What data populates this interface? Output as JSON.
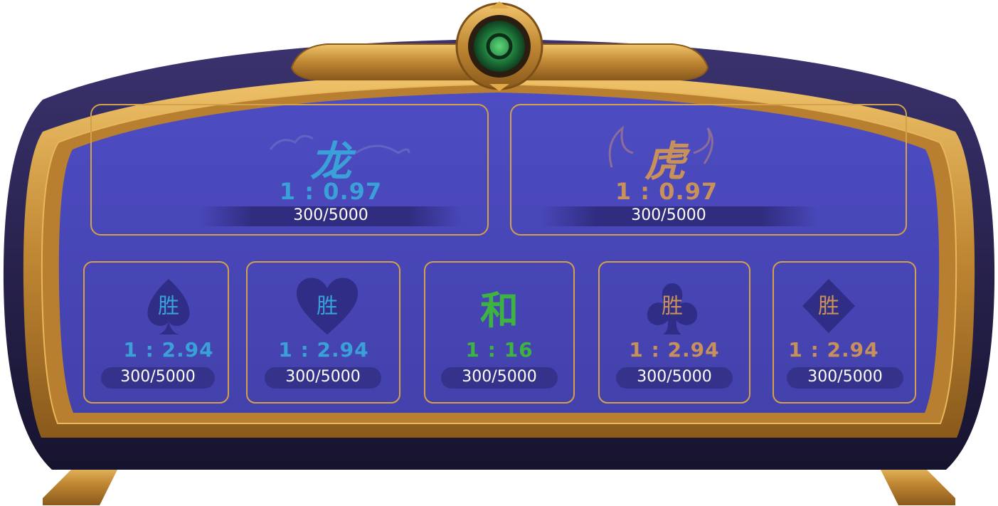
{
  "colors": {
    "felt": "#4a48b8",
    "gold": "#c9913a",
    "dragon_accent": "#3aa0d8",
    "tiger_accent": "#c8905a",
    "tie_accent": "#3db43f",
    "wood": "#2a2550"
  },
  "dragon_zone": {
    "title": "龙",
    "odds": "1 : 0.97",
    "limit": "300/5000",
    "icon": "cloud-icon"
  },
  "tiger_zone": {
    "title": "虎",
    "odds": "1 : 0.97",
    "limit": "300/5000",
    "icon": "flame-icon"
  },
  "small_zones": [
    {
      "label": "胜",
      "suit": "spade-icon",
      "odds": "1 : 2.94",
      "limit": "300/5000"
    },
    {
      "label": "胜",
      "suit": "heart-icon",
      "odds": "1 : 2.94",
      "limit": "300/5000"
    },
    {
      "label": "和",
      "suit": "",
      "odds": "1 : 16",
      "limit": "300/5000"
    },
    {
      "label": "胜",
      "suit": "club-icon",
      "odds": "1 : 2.94",
      "limit": "300/5000"
    },
    {
      "label": "胜",
      "suit": "diamond-icon",
      "odds": "1 : 2.94",
      "limit": "300/5000"
    }
  ],
  "emblem": {
    "icon": "jade-emblem-icon"
  }
}
